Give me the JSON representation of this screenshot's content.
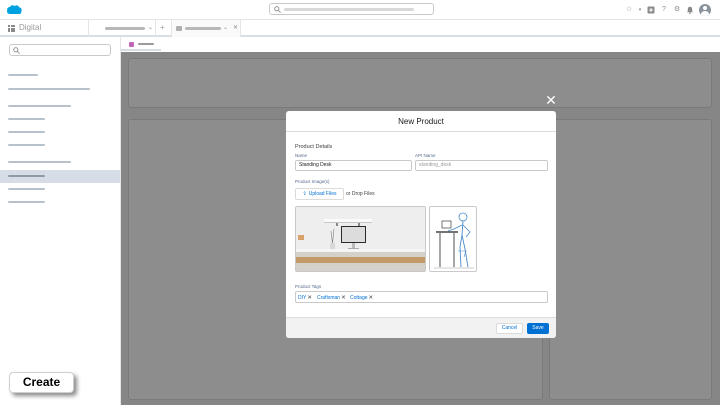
{
  "header": {
    "app_name": "Digital",
    "icons": [
      "favorites-icon",
      "favorites-list-icon",
      "global-actions-icon",
      "help-icon",
      "setup-gear-icon",
      "notifications-bell-icon",
      "avatar"
    ]
  },
  "modal": {
    "title": "New Product",
    "section_title": "Product Details",
    "name_label": "Name",
    "name_value": "Standing Desk",
    "api_name_label": "API Name",
    "api_name_placeholder": "standing_desk",
    "images_label": "Product Image(s)",
    "upload_label": "Upload Files",
    "drop_text": "or Drop Files",
    "tags_label": "Product Tags",
    "tags": [
      "DIY",
      "Craftsman",
      "Cottage"
    ],
    "cancel_label": "Cancel",
    "save_label": "Save"
  },
  "callout": {
    "label": "Create"
  },
  "colors": {
    "brand_blue": "#0070d2",
    "sidebar_active": "#d7dde6",
    "logo_blue": "#00a1e0"
  }
}
